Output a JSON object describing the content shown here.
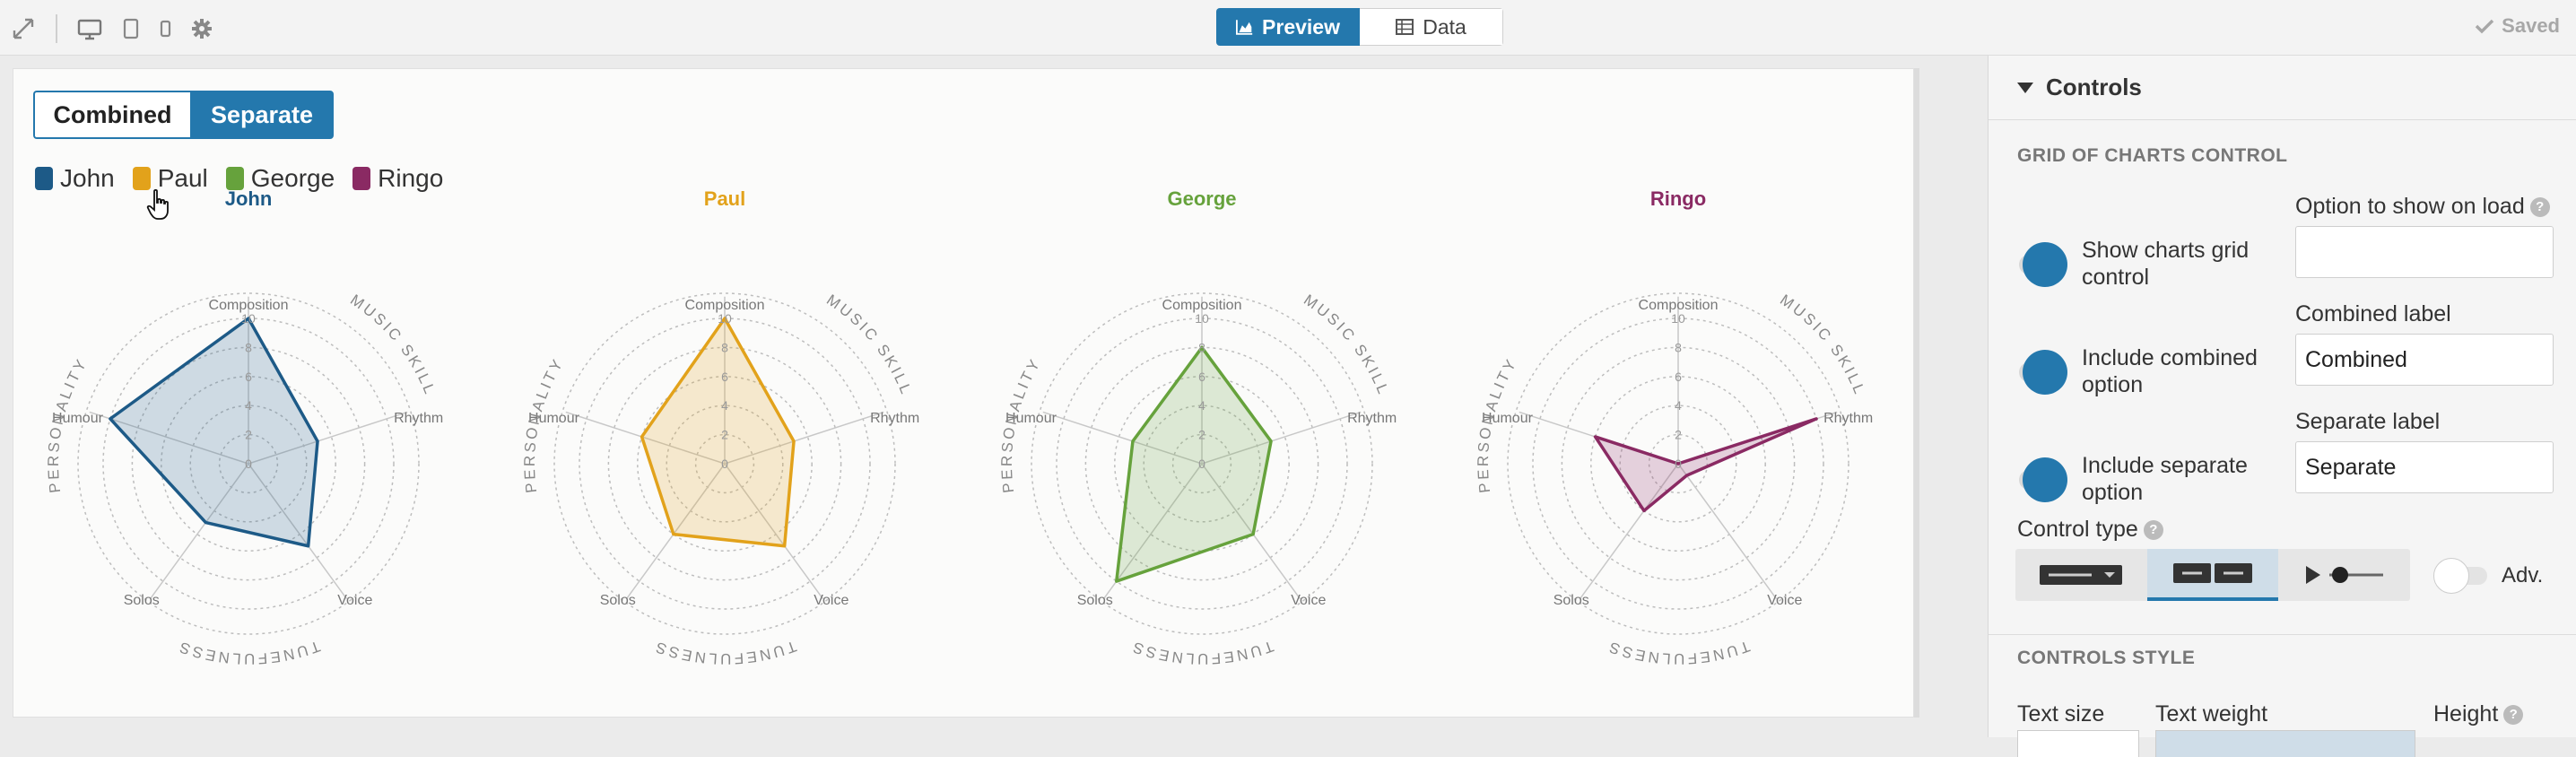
{
  "topbar": {
    "view_tabs": [
      {
        "label": "Preview",
        "icon": "chart-area-icon",
        "selected": true
      },
      {
        "label": "Data",
        "icon": "table-icon",
        "selected": false
      }
    ],
    "saved_label": "Saved",
    "accent": "#2478ad"
  },
  "preview": {
    "mode_buttons": {
      "combined": "Combined",
      "separate": "Separate"
    },
    "legend": [
      {
        "name": "John",
        "color": "#1d5a87"
      },
      {
        "name": "Paul",
        "color": "#e2a21b"
      },
      {
        "name": "George",
        "color": "#66a23c"
      },
      {
        "name": "Ringo",
        "color": "#8a2a63"
      }
    ]
  },
  "chart_data": {
    "type": "radar",
    "axes": [
      "Composition",
      "Rhythm",
      "Voice",
      "Solos",
      "Humour"
    ],
    "rlim": [
      0,
      10
    ],
    "ticks": [
      0,
      2,
      4,
      6,
      8,
      10
    ],
    "group_labels": [
      "MUSIC SKILL",
      "TUNEFULNESS",
      "PERSONALITY"
    ],
    "series": [
      {
        "name": "John",
        "color": "#1d5a87",
        "values": [
          10,
          5,
          7,
          5,
          10
        ]
      },
      {
        "name": "Paul",
        "color": "#e2a21b",
        "values": [
          10,
          5,
          7,
          6,
          6
        ]
      },
      {
        "name": "George",
        "color": "#66a23c",
        "values": [
          8,
          5,
          6,
          10,
          5
        ]
      },
      {
        "name": "Ringo",
        "color": "#8a2a63",
        "values": [
          0,
          10,
          1,
          4,
          6
        ]
      }
    ]
  },
  "panel": {
    "title": "Controls",
    "section1": "GRID OF CHARTS CONTROL",
    "toggles": [
      {
        "label1": "Show charts grid",
        "label2": "control",
        "on": true
      },
      {
        "label1": "Include combined",
        "label2": "option",
        "on": true
      },
      {
        "label1": "Include separate",
        "label2": "option",
        "on": true
      }
    ],
    "option_on_load_label": "Option to show on load",
    "option_on_load_value": "",
    "combined_label_title": "Combined label",
    "combined_label_value": "Combined",
    "separate_label_title": "Separate label",
    "separate_label_value": "Separate",
    "control_type_label": "Control type",
    "control_type_options": [
      "dropdown",
      "buttons",
      "slider"
    ],
    "control_type_selected": "buttons",
    "adv_label": "Adv.",
    "section2": "CONTROLS STYLE",
    "style_labels": {
      "text_size": "Text size",
      "text_weight": "Text weight",
      "height": "Height"
    }
  }
}
